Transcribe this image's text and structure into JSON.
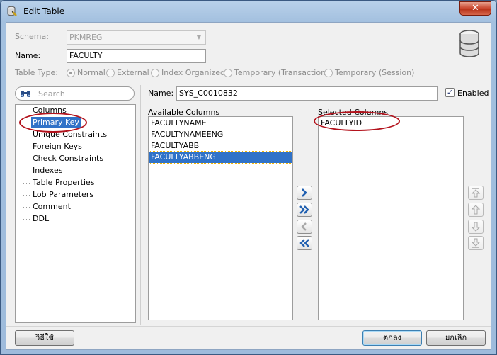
{
  "window": {
    "title": "Edit Table",
    "close_label": "✕"
  },
  "schema": {
    "label": "Schema:",
    "value": "PKMREG"
  },
  "name": {
    "label": "Name:",
    "value": "FACULTY"
  },
  "table_type": {
    "label": "Table Type:",
    "options": [
      "Normal",
      "External",
      "Index Organized",
      "Temporary (Transaction)",
      "Temporary (Session)"
    ],
    "selected": "Normal"
  },
  "search": {
    "placeholder": "Search"
  },
  "nav": {
    "items": [
      "Columns",
      "Primary Key",
      "Unique Constraints",
      "Foreign Keys",
      "Check Constraints",
      "Indexes",
      "Table Properties",
      "Lob Parameters",
      "Comment",
      "DDL"
    ],
    "selected": "Primary Key"
  },
  "pk": {
    "name_label": "Name:",
    "name_value": "SYS_C0010832",
    "enabled_label": "Enabled",
    "enabled": true
  },
  "available": {
    "label": "Available Columns",
    "items": [
      "FACULTYNAME",
      "FACULTYNAMEENG",
      "FACULTYABB",
      "FACULTYABBENG"
    ],
    "selected": "FACULTYABBENG"
  },
  "selected_cols": {
    "label": "Selected Columns",
    "items": [
      "FACULTYID"
    ]
  },
  "move_buttons": [
    "move-right-icon",
    "move-all-right-icon",
    "move-left-icon",
    "move-all-left-icon"
  ],
  "order_buttons": [
    "move-top-icon",
    "move-up-icon",
    "move-down-icon",
    "move-bottom-icon"
  ],
  "footer": {
    "help": "วิธีใช้",
    "ok": "ตกลง",
    "cancel": "ยกเลิก"
  },
  "colors": {
    "selection": "#3072c8",
    "annotation": "#b3121c",
    "titlebar": "#a3c0df"
  }
}
